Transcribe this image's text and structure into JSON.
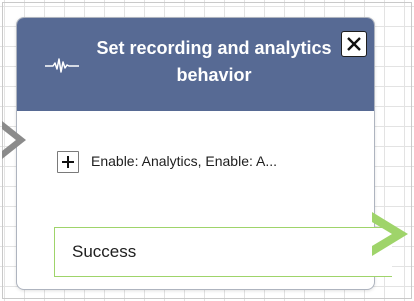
{
  "block": {
    "title": "Set recording and analytics behavior",
    "header_icon": "waveform-icon",
    "close_icon": "close-icon",
    "parameter": {
      "expand_icon": "plus-icon",
      "summary": "Enable: Analytics, Enable: A..."
    },
    "branches": [
      {
        "label": "Success",
        "connector_icon": "chevron-right-icon"
      }
    ],
    "input_connector_icon": "chevron-right-icon"
  },
  "colors": {
    "header_bg": "#576a94",
    "success_border": "#9fd46a",
    "connector_gray": "#8b8b8b"
  }
}
